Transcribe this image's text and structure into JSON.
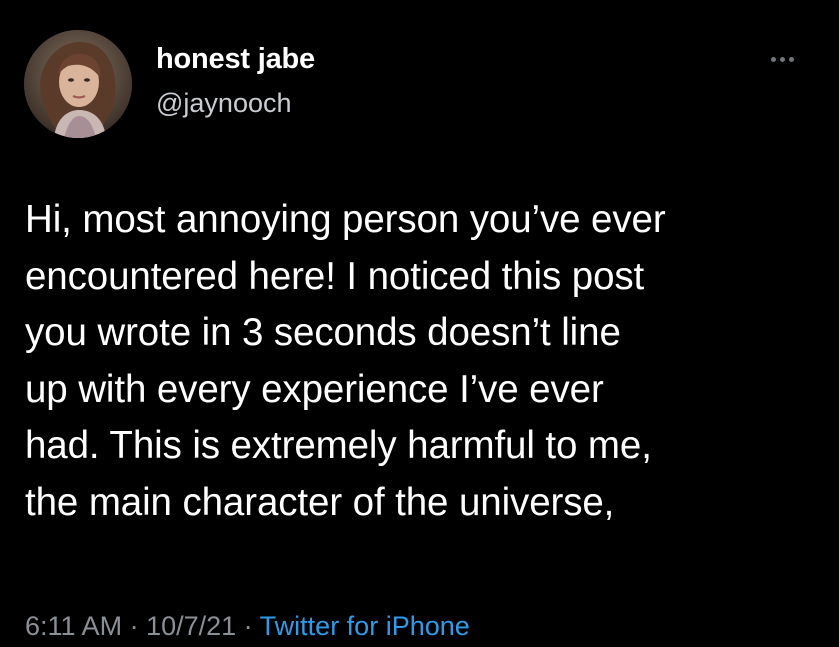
{
  "tweet": {
    "author": {
      "display_name": "honest jabe",
      "handle": "@jaynooch"
    },
    "more_icon": "more-horizontal-icon",
    "text_lines": [
      "Hi, most annoying person you’ve ever",
      "encountered here! I noticed this post",
      "you wrote in 3 seconds doesn’t line",
      "up with every experience I’ve ever",
      "had. This is extremely harmful to me,",
      "the main character of the universe,"
    ],
    "time": "6:11 AM",
    "separator": " · ",
    "date": "10/7/21",
    "source": "Twitter for iPhone"
  },
  "colors": {
    "background": "#000000",
    "text": "#ffffff",
    "secondary": "#8b9096",
    "link": "#2f9be8"
  }
}
